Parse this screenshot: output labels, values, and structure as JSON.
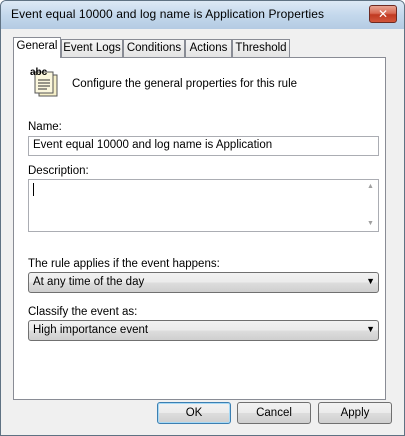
{
  "window": {
    "title": "Event equal 10000 and log name is Application Properties",
    "close_label": "✕"
  },
  "tabs": [
    {
      "label": "General",
      "active": true
    },
    {
      "label": "Event Logs",
      "active": false
    },
    {
      "label": "Conditions",
      "active": false
    },
    {
      "label": "Actions",
      "active": false
    },
    {
      "label": "Threshold",
      "active": false
    }
  ],
  "general": {
    "icon": "rule-properties-icon",
    "icon_text": "abc",
    "header": "Configure the general properties for this rule",
    "name_label": "Name:",
    "name_value": "Event equal 10000 and log name is Application",
    "description_label": "Description:",
    "description_value": "",
    "applies_label": "The rule applies if the event happens:",
    "applies_value": "At any time of the day",
    "classify_label": "Classify the event as:",
    "classify_value": "High importance event"
  },
  "buttons": {
    "ok": "OK",
    "cancel": "Cancel",
    "apply": "Apply"
  }
}
